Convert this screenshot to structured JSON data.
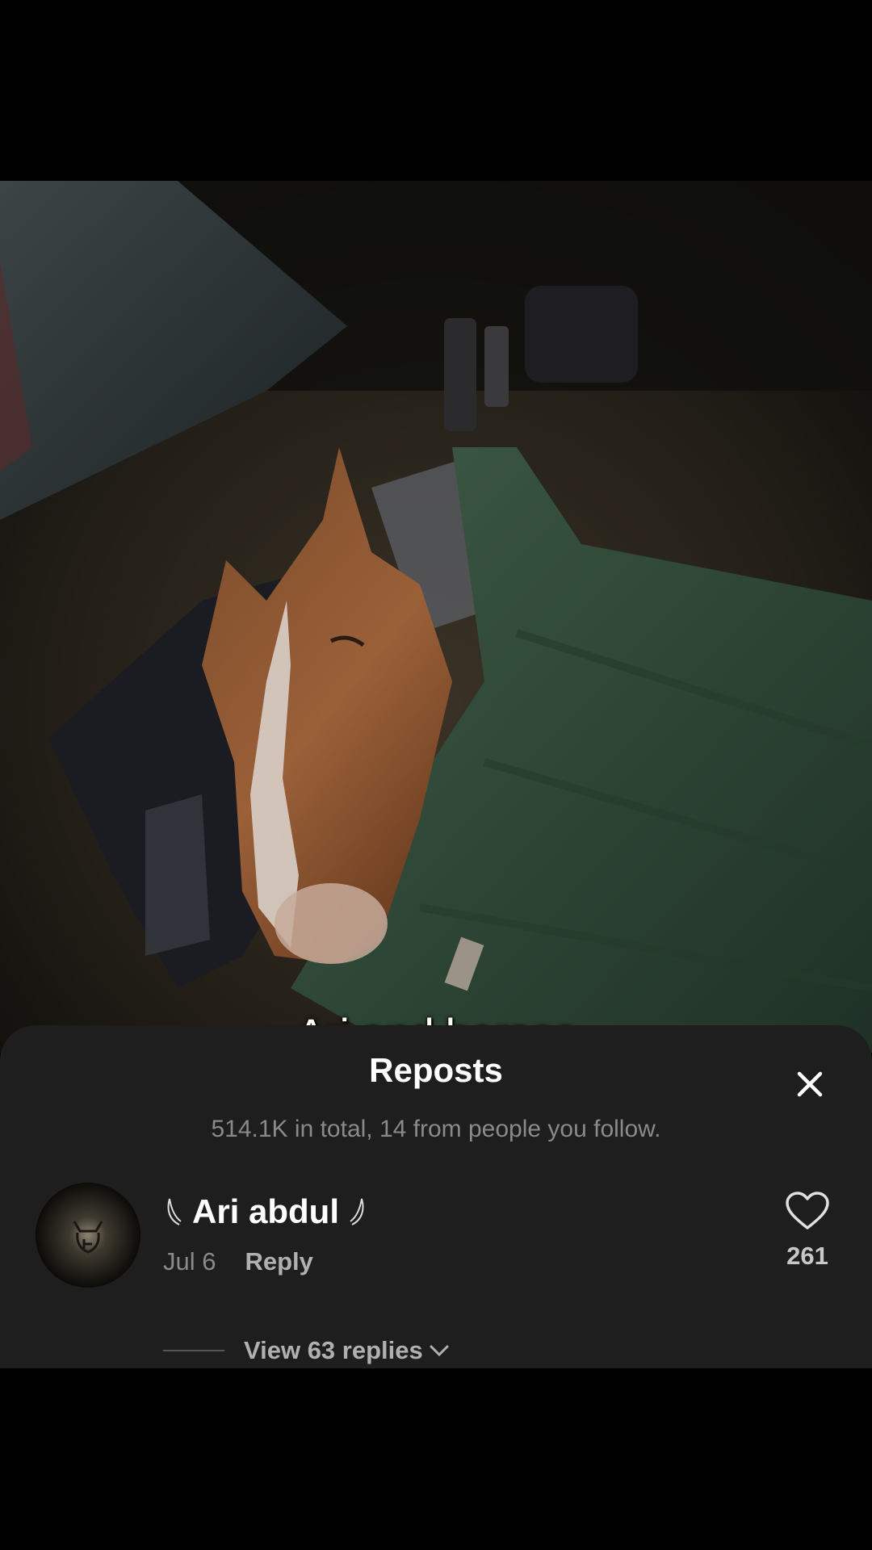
{
  "video": {
    "caption": "Ari and horses"
  },
  "sheet": {
    "title": "Reposts",
    "subtitle": "514.1K in total, 14 from people you follow.",
    "close_icon": "close-icon"
  },
  "comment": {
    "user_name": "Ari abdul",
    "date": "Jul 6",
    "reply_label": "Reply",
    "like_count": "261",
    "like_icon": "heart-outline-icon",
    "view_replies_label": "View 63 replies"
  },
  "colors": {
    "sheet_bg": "#1e1e1e",
    "secondary_text": "#8a8a8a",
    "primary_text": "#ffffff"
  }
}
